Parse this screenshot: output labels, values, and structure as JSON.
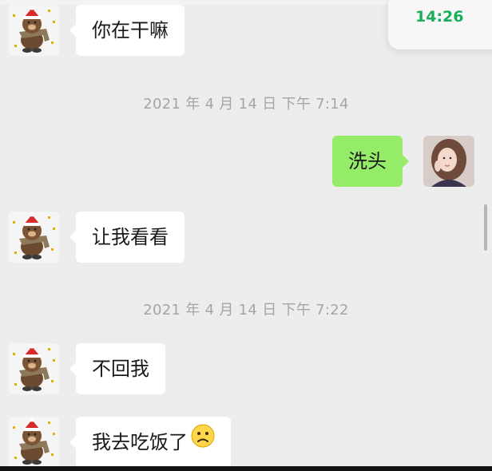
{
  "status": {
    "time": "14:26"
  },
  "messages": [
    {
      "side": "in",
      "text": "你在干嘛"
    },
    {
      "type": "timestamp",
      "text": "2021 年 4 月 14 日 下午 7:14"
    },
    {
      "side": "out",
      "text": "洗头"
    },
    {
      "side": "in",
      "text": "让我看看"
    },
    {
      "type": "timestamp",
      "text": "2021 年 4 月 14 日 下午 7:22"
    },
    {
      "side": "in",
      "text": "不回我"
    },
    {
      "side": "in",
      "text": "我去吃饭了",
      "emoji": "frowning-face-icon"
    }
  ],
  "avatars": {
    "contact": "brown-bear-santa-hat-sticker",
    "self": "woman-portrait-photo"
  },
  "colors": {
    "background": "#ededed",
    "incoming_bubble": "#ffffff",
    "outgoing_bubble": "#95ec69",
    "time_text": "#1aad5b",
    "timestamp_text": "#a5a5a5"
  }
}
